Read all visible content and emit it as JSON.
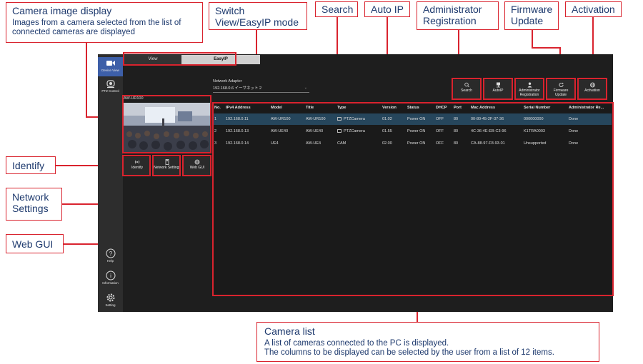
{
  "callouts": {
    "camera_image": {
      "title": "Camera image display",
      "desc": "Images from a camera selected from the list of connected cameras are displayed"
    },
    "switch_mode": {
      "title": "Switch View/EasyIP mode"
    },
    "search": {
      "title": "Search"
    },
    "auto_ip": {
      "title": "Auto IP"
    },
    "admin_reg": {
      "title": "Administrator Registration"
    },
    "firmware": {
      "title": "Firmware Update"
    },
    "activation": {
      "title": "Activation"
    },
    "identify": {
      "title": "Identify"
    },
    "network_settings": {
      "title": "Network Settings"
    },
    "web_gui": {
      "title": "Web GUI"
    },
    "camera_list": {
      "title": "Camera list",
      "desc1": "A list of cameras connected to the PC is displayed.",
      "desc2": "The columns to be displayed can be selected by the user from a list of 12 items."
    }
  },
  "sidebar": {
    "device_view": "Device View",
    "ptz_control": "PTZ Control",
    "help": "Help",
    "information": "Information",
    "setting": "Setting"
  },
  "tabs": {
    "view": "View",
    "easyip": "EasyIP"
  },
  "preview": {
    "title": "AW-UR100"
  },
  "preview_buttons": {
    "identify": "Identify",
    "network_settings": "Network Settings",
    "web_gui": "Web GUI"
  },
  "adapter": {
    "label": "Network Adapter",
    "value": "192.168.0.6 イーサネット 2"
  },
  "toolbar": {
    "search": "Search",
    "autoip": "AutoIP",
    "admin": "Administrator Registration",
    "firmware": "Firmware Update",
    "activation": "Activation"
  },
  "table": {
    "headers": [
      "No.",
      "IPv4 Address",
      "Model",
      "Title",
      "Type",
      "Version",
      "Status",
      "DHCP",
      "Port",
      "Mac Address",
      "Serial Number",
      "Administrator Re..."
    ],
    "rows": [
      [
        "1",
        "192.168.0.11",
        "AW-UR100",
        "AW-UR100",
        "PTZCamera",
        "01.02",
        "Power ON",
        "OFF",
        "80",
        "00-80-45-2F-37-36",
        "000000000",
        "Done"
      ],
      [
        "2",
        "192.168.0.13",
        "AW-UE40",
        "AW-UE40",
        "PTZCamera",
        "01.55",
        "Power ON",
        "OFF",
        "80",
        "4C-36-4E-EB-C3-96",
        "K1TRA0003",
        "Done"
      ],
      [
        "3",
        "192.168.0.14",
        "UE4",
        "AW-UE4",
        "CAM",
        "02.00",
        "Power ON",
        "OFF",
        "80",
        "CA-88-97-F8-93-01",
        "Unsupported",
        "Done"
      ]
    ]
  },
  "colors": {
    "accent_red": "#d9232e",
    "callout_text": "#1e3a6e",
    "selected_row": "#26465c",
    "active_nav": "#3d5fa8"
  }
}
